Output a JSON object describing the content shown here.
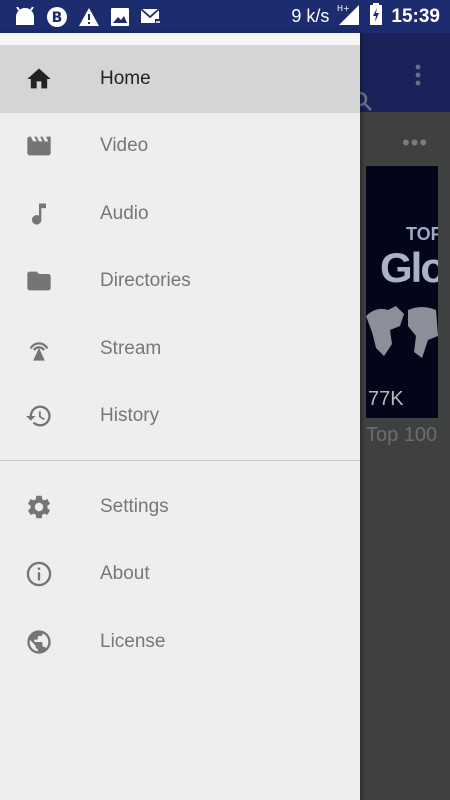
{
  "status_bar": {
    "speed": "9 k/s",
    "network": "H+",
    "time": "15:39",
    "icons": [
      "android-icon",
      "b-app-icon",
      "warning-icon",
      "image-icon",
      "mail-icon",
      "signal-icon",
      "battery-charging-icon"
    ]
  },
  "background": {
    "thumbnail_line1": "TOP",
    "thumbnail_line2": "Glo",
    "views": "77K",
    "title": "Top 100"
  },
  "drawer": {
    "main_items": [
      {
        "label": "Home",
        "icon": "home-icon",
        "selected": true
      },
      {
        "label": "Video",
        "icon": "video-icon"
      },
      {
        "label": "Audio",
        "icon": "music-note-icon"
      },
      {
        "label": "Directories",
        "icon": "folder-icon"
      },
      {
        "label": "Stream",
        "icon": "stream-icon"
      },
      {
        "label": "History",
        "icon": "history-icon"
      }
    ],
    "secondary_items": [
      {
        "label": "Settings",
        "icon": "gear-icon"
      },
      {
        "label": "About",
        "icon": "info-icon"
      },
      {
        "label": "License",
        "icon": "globe-icon"
      }
    ]
  },
  "colors": {
    "status_bar": "#1c2c6e",
    "drawer_bg": "#eeeeee",
    "selected_bg": "#d5d5d5",
    "icon_gray": "#757575"
  }
}
